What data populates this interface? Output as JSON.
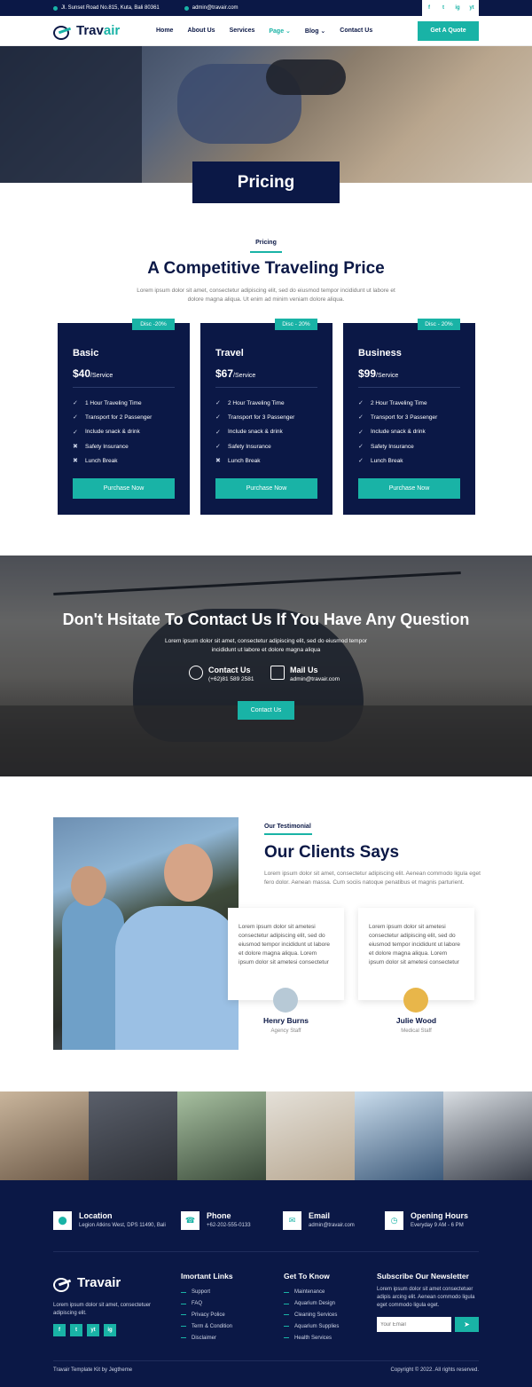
{
  "topbar": {
    "address": "Jl. Sunset Road No.815, Kuta, Bali 80361",
    "email": "admin@travair.com",
    "social": [
      "f",
      "t",
      "ig",
      "yt"
    ]
  },
  "header": {
    "logo_a": "Trav",
    "logo_b": "air",
    "nav": [
      {
        "label": "Home"
      },
      {
        "label": "About Us"
      },
      {
        "label": "Services"
      },
      {
        "label": "Page ⌄"
      },
      {
        "label": "Blog ⌄"
      },
      {
        "label": "Contact Us"
      }
    ],
    "quote_label": "Get A Quote"
  },
  "hero": {
    "title": "Pricing"
  },
  "pricing": {
    "eyebrow": "Pricing",
    "title": "A Competitive Traveling Price",
    "lead": "Lorem ipsum dolor sit amet, consectetur adipiscing elit, sed do eiusmod tempor incididunt ut labore et dolore magna aliqua. Ut enim ad minim veniam dolore aliqua.",
    "plans": [
      {
        "disc": "Disc -20%",
        "name": "Basic",
        "price": "$40",
        "unit": "/Service",
        "features": [
          {
            "mark": "✓",
            "text": "1 Hour Traveling Time"
          },
          {
            "mark": "✓",
            "text": "Transport for 2 Passenger"
          },
          {
            "mark": "✓",
            "text": "Include snack & drink"
          },
          {
            "mark": "✖",
            "text": "Safety Insurance"
          },
          {
            "mark": "✖",
            "text": "Lunch Break"
          }
        ],
        "button": "Purchase Now"
      },
      {
        "disc": "Disc - 20%",
        "name": "Travel",
        "price": "$67",
        "unit": "/Service",
        "features": [
          {
            "mark": "✓",
            "text": "2 Hour Traveling Time"
          },
          {
            "mark": "✓",
            "text": "Transport for 3 Passenger"
          },
          {
            "mark": "✓",
            "text": "Include snack & drink"
          },
          {
            "mark": "✓",
            "text": "Safety Insurance"
          },
          {
            "mark": "✖",
            "text": "Lunch Break"
          }
        ],
        "button": "Purchase Now"
      },
      {
        "disc": "Disc - 20%",
        "name": "Business",
        "price": "$99",
        "unit": "/Service",
        "features": [
          {
            "mark": "✓",
            "text": "2 Hour Traveling Time"
          },
          {
            "mark": "✓",
            "text": "Transport for 3 Passenger"
          },
          {
            "mark": "✓",
            "text": "Include snack & drink"
          },
          {
            "mark": "✓",
            "text": "Safety Insurance"
          },
          {
            "mark": "✓",
            "text": "Lunch Break"
          }
        ],
        "button": "Purchase Now"
      }
    ]
  },
  "contact": {
    "title": "Don't Hsitate To Contact Us If You Have Any Question",
    "lead": "Lorem ipsum dolor sit amet, consectetur adipiscing elit, sed do eiusmod tempor incididunt ut labore et dolore magna aliqua",
    "phone_label": "Contact Us",
    "phone": "(+62)81 589 2581",
    "mail_label": "Mail Us",
    "mail": "admin@travair.com",
    "button": "Contact Us"
  },
  "testimonial": {
    "eyebrow": "Our Testimonial",
    "title": "Our Clients Says",
    "lead": "Lorem ipsum dolor sit amet, consectetur adipiscing elit. Aenean commodo ligula eget  fero dolor. Aenean massa. Cum sociis natoque penatibus et magnis parturient.",
    "cards": [
      {
        "text": "Lorem ipsum dolor sit ametesi consectetur adipiscing elit, sed do eiusmod tempor incididunt ut labore et dolore magna aliqua. Lorem ipsum dolor sit ametesi consectetur",
        "name": "Henry Burns",
        "role": "Agency Staff"
      },
      {
        "text": "Lorem ipsum dolor sit ametesi consectetur adipiscing elit, sed do eiusmod tempor incididunt ut labore et dolore magna aliqua. Lorem ipsum dolor sit ametesi consectetur",
        "name": "Julie Wood",
        "role": "Medical Staff"
      }
    ]
  },
  "footer": {
    "info": [
      {
        "icon": "location-icon",
        "title": "Location",
        "value": "Legion Atkins West, DPS 11490, Bali"
      },
      {
        "icon": "phone-icon",
        "title": "Phone",
        "value": "+62-202-555-0133"
      },
      {
        "icon": "email-icon",
        "title": "Email",
        "value": "admin@travair.com"
      },
      {
        "icon": "clock-icon",
        "title": "Opening Hours",
        "value": "Everyday 9 AM - 6 PM"
      }
    ],
    "logo": "Travair",
    "about": "Lorem ipsum dolor sit amet, consectetuer adipiscing elit.",
    "links_title": "Imortant Links",
    "links": [
      "Support",
      "FAQ",
      "Privacy Police",
      "Term & Condition",
      "Disclaimer"
    ],
    "know_title": "Get To Know",
    "know": [
      "Maintenance",
      "Aquarium Design",
      "Cleaning Services",
      "Aquarium Supplies",
      "Health Services"
    ],
    "news_title": "Subscribe Our Newsletter",
    "news_text": "Lorem ipsum dolor sit amet consectetuer adipis arcing elit. Aenean commodo ligula eget commodo ligula eget.",
    "news_placeholder": "Your Email",
    "credit": "Travair Template Kit by Jegtheme",
    "copyright": "Copyright © 2022. All rights reserved."
  }
}
